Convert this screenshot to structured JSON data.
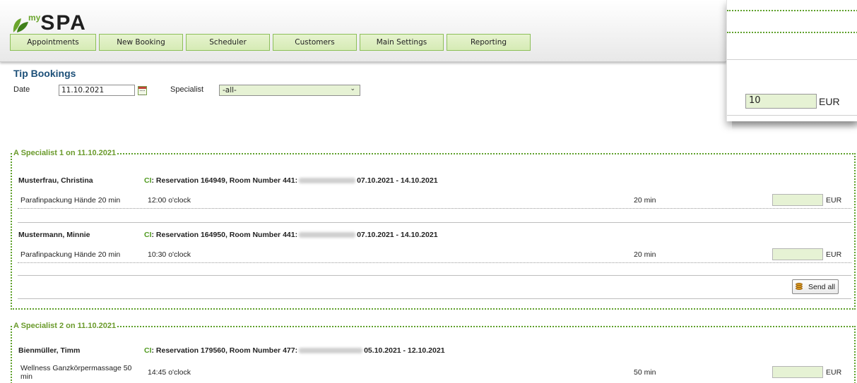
{
  "app": {
    "logo_sup": "my",
    "logo_text": "SPA"
  },
  "nav": [
    {
      "label": "Appointments"
    },
    {
      "label": "New Booking"
    },
    {
      "label": "Scheduler"
    },
    {
      "label": "Customers"
    },
    {
      "label": "Main Settings"
    },
    {
      "label": "Reporting"
    }
  ],
  "page": {
    "title": "Tip Bookings",
    "date_label": "Date",
    "date_value": "11.10.2021",
    "specialist_label": "Specialist",
    "specialist_value": "-all-"
  },
  "sections": [
    {
      "legend": "A Specialist 1 on 11.10.2021",
      "bookings": [
        {
          "customer": "Musterfrau, Christina",
          "ci": "CI",
          "reservation_pre": ": Reservation 164949, Room Number 441:",
          "reservation_post": "07.10.2021 - 14.10.2021",
          "treatment": "Parafinpackung Hände 20 min",
          "time": "12:00 o'clock",
          "duration": "20 min",
          "currency": "EUR"
        },
        {
          "customer": "Mustermann, Minnie",
          "ci": "CI",
          "reservation_pre": ": Reservation 164950, Room Number 441:",
          "reservation_post": "07.10.2021 - 14.10.2021",
          "treatment": "Parafinpackung Hände 20 min",
          "time": "10:30 o'clock",
          "duration": "20 min",
          "currency": "EUR"
        }
      ],
      "send_all": "Send all"
    },
    {
      "legend": "A Specialist 2 on 11.10.2021",
      "bookings": [
        {
          "customer": "Bienmüller, Timm",
          "ci": "CI",
          "reservation_pre": ": Reservation 179560, Room Number 477:",
          "reservation_post": "05.10.2021 - 12.10.2021",
          "treatment": "Wellness Ganzkörpermassage 50 min",
          "time": "14:45 o'clock",
          "duration": "50 min",
          "currency": "EUR"
        }
      ]
    }
  ],
  "popup": {
    "tip_value": "10",
    "currency": "EUR"
  },
  "colors": {
    "accent_green": "#5ea02a",
    "title_blue": "#1c4f78",
    "field_green": "#e6f2d4"
  }
}
